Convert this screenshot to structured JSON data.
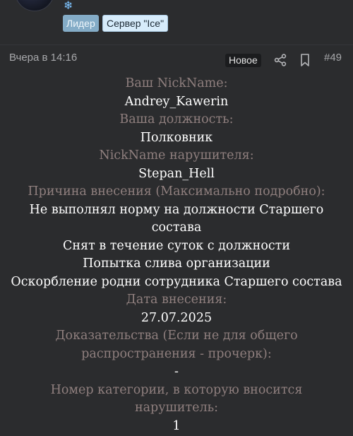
{
  "user": {
    "badges": [
      "Лидер",
      "Сервер \"Ice\""
    ],
    "snow_glyph": "❄"
  },
  "post": {
    "date": "Вчера в 14:16",
    "new_label": "Новое",
    "number": "#49"
  },
  "content": {
    "lines": [
      {
        "kind": "lbl",
        "text": "Ваш NickName:"
      },
      {
        "kind": "val",
        "text": "Andrey_Kawerin"
      },
      {
        "kind": "lbl",
        "text": "Ваша должность:"
      },
      {
        "kind": "val",
        "text": "Полковник"
      },
      {
        "kind": "lbl",
        "text": "NickName нарушителя:"
      },
      {
        "kind": "val",
        "text": "Stepan_Hell"
      },
      {
        "kind": "lbl",
        "text": "Причина внесения (Максимально подробно):"
      },
      {
        "kind": "val",
        "text": "Не выполнял норму на должности Старшего"
      },
      {
        "kind": "val",
        "text": "состава"
      },
      {
        "kind": "val",
        "text": "Снят в течение суток с должности"
      },
      {
        "kind": "val",
        "text": "Попытка слива организации"
      },
      {
        "kind": "val",
        "text": "Оскорбление родни сотрудника Старшего состава"
      },
      {
        "kind": "lbl",
        "text": "Дата внесения:"
      },
      {
        "kind": "val",
        "text": "27.07.2025"
      },
      {
        "kind": "lbl",
        "text": "Доказательства (Если не для общего"
      },
      {
        "kind": "lbl",
        "text": "распространения - прочерк):"
      },
      {
        "kind": "val",
        "text": "-"
      },
      {
        "kind": "lbl",
        "text": "Номер категории, в которую вносится"
      },
      {
        "kind": "lbl",
        "text": "нарушитель:"
      },
      {
        "kind": "val",
        "text": "1"
      }
    ]
  },
  "icons": {
    "share": "share-icon",
    "bookmark": "bookmark-icon"
  },
  "colors": {
    "background": "#2b2c2e",
    "label": "#8f7f7e",
    "value": "#ffffff",
    "leader_badge": "#84acc7",
    "server_badge": "#d7ecfb"
  }
}
